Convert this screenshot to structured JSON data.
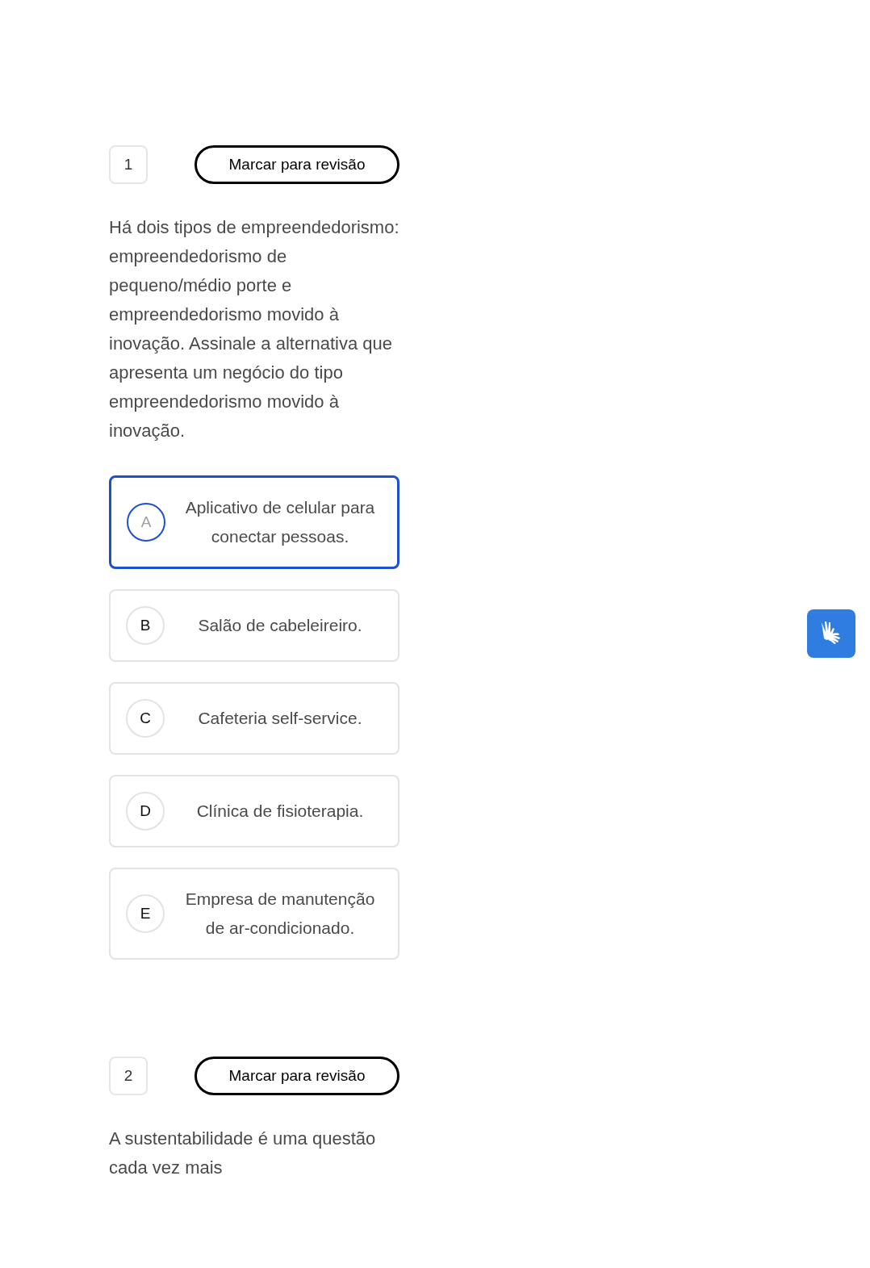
{
  "questions": [
    {
      "number": "1",
      "review_button": "Marcar para revisão",
      "text": "Há dois tipos de empreendedorismo: empreendedorismo de pequeno/médio porte e empreendedorismo movido à inovação. Assinale a alternativa que apresenta um negócio do tipo empreendedorismo movido à inovação.",
      "options": [
        {
          "letter": "A",
          "text": "Aplicativo de celular para conectar pessoas.",
          "selected": true
        },
        {
          "letter": "B",
          "text": "Salão de cabeleireiro.",
          "selected": false
        },
        {
          "letter": "C",
          "text": "Cafeteria self-service.",
          "selected": false
        },
        {
          "letter": "D",
          "text": "Clínica de fisioterapia.",
          "selected": false
        },
        {
          "letter": "E",
          "text": "Empresa de manutenção de ar-condicionado.",
          "selected": false
        }
      ]
    },
    {
      "number": "2",
      "review_button": "Marcar para revisão",
      "text": "A sustentabilidade é uma questão cada vez mais"
    }
  ]
}
